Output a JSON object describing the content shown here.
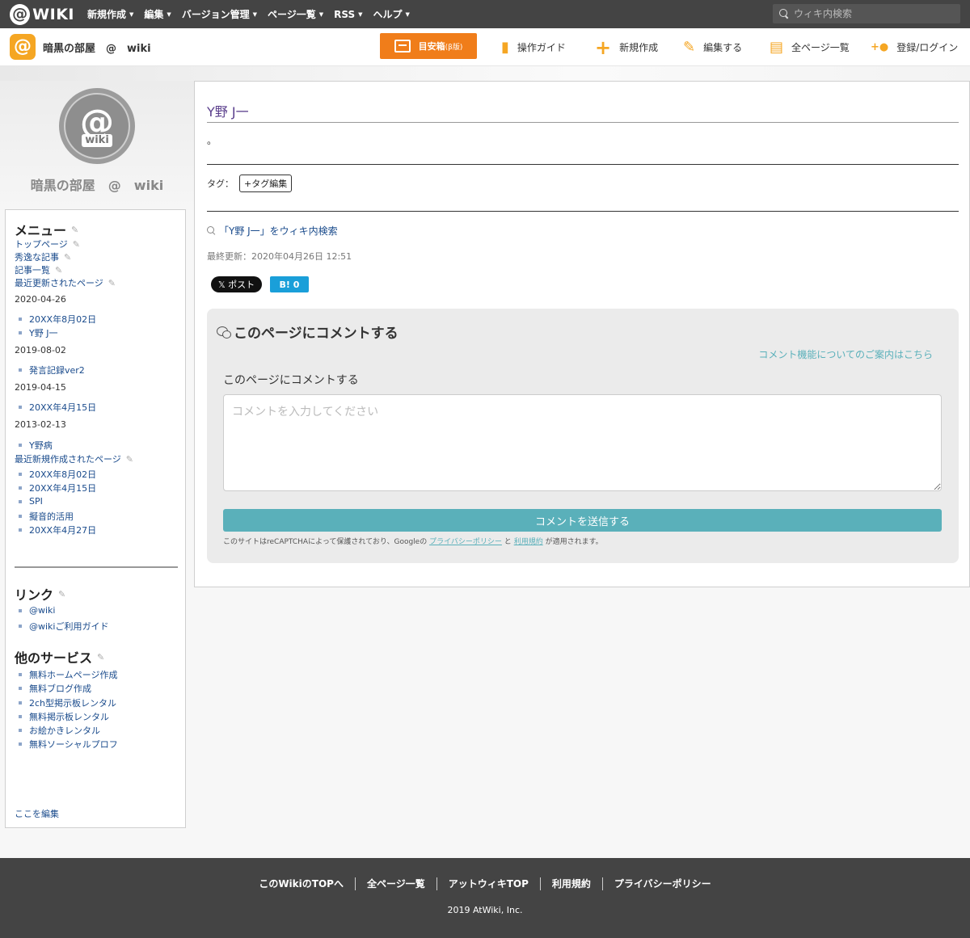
{
  "topbar": {
    "logo_at": "@",
    "logo_word": "WIKI",
    "nav": [
      {
        "label": "新規作成"
      },
      {
        "label": "編集"
      },
      {
        "label": "バージョン管理"
      },
      {
        "label": "ページ一覧"
      },
      {
        "label": "RSS"
      },
      {
        "label": "ヘルプ"
      }
    ],
    "caret": "▼",
    "search_placeholder": "ウィキ内検索"
  },
  "header": {
    "logo_glyph": "@",
    "site_name": "暗黒の部屋　@　wiki",
    "meyasu_label": "目安箱",
    "meyasu_beta": "(β版)",
    "nav": [
      {
        "label": "操作ガイド",
        "icon": "guide-icon",
        "glyph": "▮"
      },
      {
        "label": "新規作成",
        "icon": "plus-icon",
        "glyph": "+"
      },
      {
        "label": "編集する",
        "icon": "pencil-icon",
        "glyph": "✎"
      },
      {
        "label": "全ページ一覧",
        "icon": "document-icon",
        "glyph": "▤"
      },
      {
        "label": "登録/ログイン",
        "icon": "add-user-icon",
        "glyph": "+●"
      }
    ]
  },
  "sidebar": {
    "big_logo_at": "@",
    "big_logo_word": "wiki",
    "site_title": "暗黒の部屋　@　wiki",
    "pen_glyph": "✎",
    "menu_heading": "メニュー",
    "menu_links": [
      "トップページ",
      "秀逸な記事",
      "記事一覧",
      "最近更新されたページ"
    ],
    "recent_updated": [
      {
        "date": "2020-04-26",
        "items": [
          "20XX年8月02日",
          "Y野 J一"
        ]
      },
      {
        "date": "2019-08-02",
        "items": [
          "発言記録ver2"
        ]
      },
      {
        "date": "2019-04-15",
        "items": [
          "20XX年4月15日"
        ]
      },
      {
        "date": "2013-02-13",
        "items": [
          "Y野病"
        ]
      }
    ],
    "recent_new_heading": "最近新規作成されたページ",
    "recent_new": [
      "20XX年8月02日",
      "20XX年4月15日",
      "SPI",
      "擬音的活用",
      "20XX年4月27日"
    ],
    "links_heading": "リンク",
    "links": [
      "@wiki",
      "@wikiご利用ガイド"
    ],
    "services_heading": "他のサービス",
    "services": [
      "無料ホームページ作成",
      "無料ブログ作成",
      "2ch型掲示板レンタル",
      "無料掲示板レンタル",
      "お絵かきレンタル",
      "無料ソーシャルプロフ"
    ],
    "edit_here": "ここを編集"
  },
  "main": {
    "page_title": "Y野 J一",
    "body_text": "。",
    "tag_label": "タグ：",
    "tag_edit": "+タグ編集",
    "wiki_search": "「Y野 J一」をウィキ内検索",
    "last_updated": "最終更新：2020年04月26日 12:51",
    "x_button": "𝕏 ポスト",
    "hatena_button": "B! 0"
  },
  "comment": {
    "title": "このページにコメントする",
    "notice_link": "コメント機能についてのご案内はこちら",
    "label": "このページにコメントする",
    "placeholder": "コメントを入力してください",
    "submit": "コメントを送信する",
    "note_prefix": "このサイトはreCAPTCHAによって保護されており、Googleの",
    "privacy": "プライバシーポリシー",
    "and": "と",
    "terms": "利用規約",
    "note_suffix": "が適用されます。"
  },
  "footer": {
    "links": [
      "このWikiのTOPへ",
      "全ページ一覧",
      "アットウィキTOP",
      "利用規約",
      "プライバシーポリシー"
    ],
    "copyright": "2019 AtWiki, Inc."
  },
  "colors": {
    "topbar": "#444444",
    "accent_orange": "#f07d1a",
    "link": "#1a4b8c",
    "teal": "#5ab0ba"
  }
}
